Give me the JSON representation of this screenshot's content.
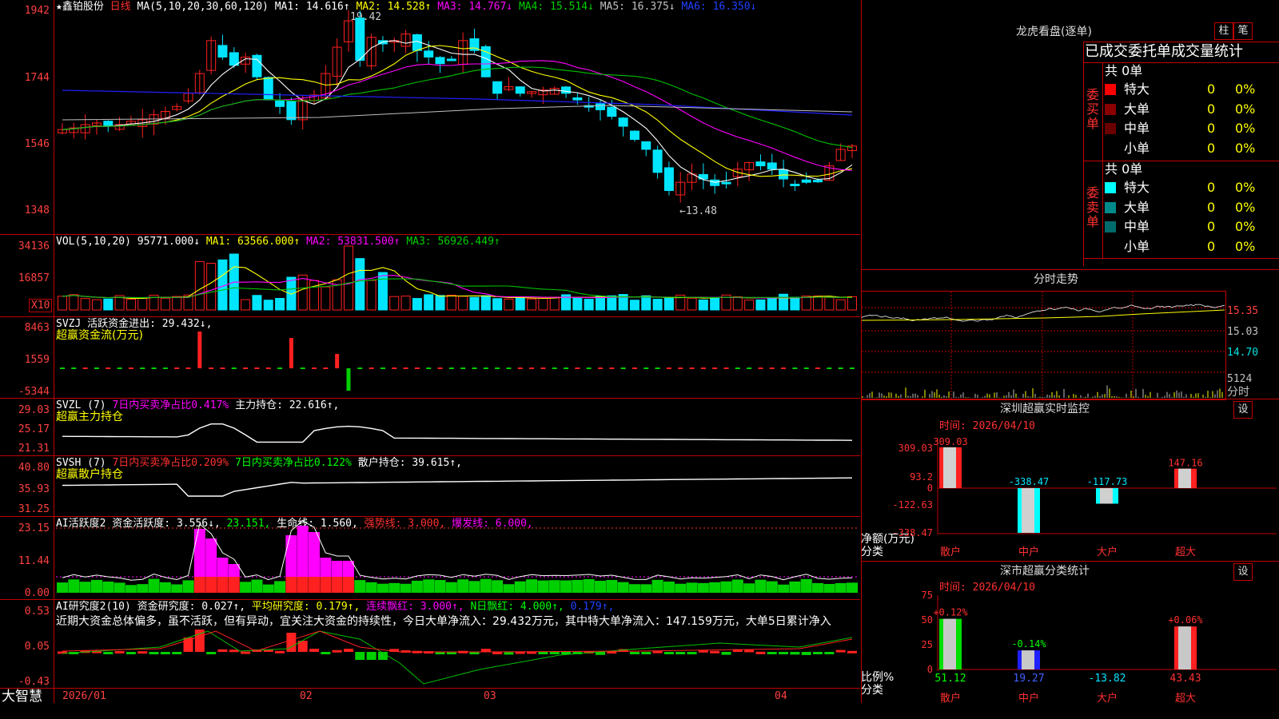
{
  "colors": {
    "up": "#ff2020",
    "down": "#00e5ff",
    "border": "#c00000",
    "axis": "#ff3030",
    "white": "#ffffff",
    "yellow": "#ffff00",
    "magenta": "#ff00ff",
    "green": "#00c000",
    "blue": "#2020ff",
    "gray": "#c0c0c0"
  },
  "main": {
    "star_name": "★鑫铂股份",
    "period": "日线",
    "ma_label": "MA(5,10,20,30,60,120)",
    "ma1": "MA1: 14.616↑",
    "ma2": "MA2: 14.528↑",
    "ma3": "MA3: 14.767↓",
    "ma4": "MA4: 15.514↓",
    "ma5": "MA5: 16.375↓",
    "ma6": "MA6: 16.350↓",
    "y_ticks": [
      "1942",
      "1744",
      "1546",
      "1348"
    ],
    "high_mark": "19.42",
    "low_mark": "←13.48",
    "x_dates": [
      "2026/01",
      "02",
      "03",
      "04"
    ]
  },
  "vol": {
    "label": "VOL(5,10,20)",
    "v": "95771.000↓",
    "ma1": "MA1: 63566.000↑",
    "ma2": "MA2: 53831.500↑",
    "ma3": "MA3: 56926.449↑",
    "y_ticks": [
      "34136",
      "16857"
    ],
    "unit": "X10"
  },
  "svzj": {
    "title": "SVZJ  活跃资金进出: 29.432↓,",
    "sub": "超赢资金流(万元)",
    "y_ticks": [
      "8463",
      "1559",
      "-5344"
    ]
  },
  "svzl": {
    "prefix": "SVZL (7)",
    "p1": "7日内买卖净占比0.417%",
    "p2": "主力持仓: 22.616↑,",
    "sub": "超赢主力持仓",
    "y_ticks": [
      "29.03",
      "25.17",
      "21.31"
    ]
  },
  "svsh": {
    "prefix": "SVSH (7)",
    "p1": "7日内买卖净占比0.209%",
    "p2": "7日内买卖净占比0.122%",
    "p3": "散户持仓: 39.615↑,",
    "sub": "超赢散户持仓",
    "y_ticks": [
      "40.80",
      "35.93",
      "31.25"
    ]
  },
  "ai_act": {
    "title": "AI活跃度2  资金活跃度: 3.556↓,",
    "v2": "23.151,",
    "life": "生命线: 1.560,",
    "strong": "强势线: 3.000,",
    "burst": "爆发线: 6.000,",
    "y_ticks": [
      "23.15",
      "11.44",
      "0.00"
    ]
  },
  "ai_res": {
    "title": "AI研究度2(10)  资金研究度: 0.027↑,",
    "avg": "平均研究度: 0.179↑,",
    "red": "连续飘红: 3.000↑,",
    "nred": "N日飘红: 4.000↑,",
    "v": "0.179↑,",
    "comment": "近期大资金总体偏多，虽不活跃，但有异动，宜关注大资金的持续性，今日大单净流入：29.432万元，其中特大单净流入：147.159万元，大单5日累计净入",
    "y_ticks": [
      "0.53",
      "0.05",
      "-0.43"
    ]
  },
  "logo": "大智慧",
  "right": {
    "lhb_title": "龙虎看盘(逐单)",
    "btn_bar": "柱",
    "btn_pen": "笔",
    "tabs_line": "已成交委托单成交量统计",
    "buy_side": "委买单",
    "sell_side": "委卖单",
    "buy_total": "共 0单",
    "sell_total": "共 0单",
    "rows": [
      {
        "label": "特大",
        "count": "0",
        "pct": "0%"
      },
      {
        "label": "大单",
        "count": "0",
        "pct": "0%"
      },
      {
        "label": "中单",
        "count": "0",
        "pct": "0%"
      },
      {
        "label": "小单",
        "count": "0",
        "pct": "0%"
      }
    ],
    "intraday_title": "分时走势",
    "intraday_ticks": [
      "15.35",
      "15.03",
      "14.70",
      "5124",
      "分时"
    ],
    "sz_title": "深圳超赢实时监控",
    "sz_time": "时间: 2026/04/10",
    "sz_btn": "设",
    "sz_y": [
      "309.03",
      "93.2",
      "0",
      "-122.63",
      "-338.47"
    ],
    "sz_ylabel": "净额(万元)",
    "sz_xlabel": "分类",
    "sz_bars": [
      {
        "cat": "散户",
        "value": 309.03,
        "label": "309.03"
      },
      {
        "cat": "中户",
        "value": -338.47,
        "label": "-338.47"
      },
      {
        "cat": "大户",
        "value": -117.73,
        "label": "-117.73"
      },
      {
        "cat": "超大",
        "value": 147.16,
        "label": "147.16"
      }
    ],
    "cls_title": "深市超赢分类统计",
    "cls_time": "时间: 2026/04/10",
    "cls_btn": "设",
    "cls_y": [
      "75",
      "50",
      "25",
      "0"
    ],
    "cls_ylabel": "比例%",
    "cls_xlabel": "分类",
    "cls_bars": [
      {
        "cat": "散户",
        "value": 51.12,
        "label": "51.12",
        "top": "+0.12%"
      },
      {
        "cat": "中户",
        "value": 19.27,
        "label": "19.27",
        "top": "-0.14%"
      },
      {
        "cat": "大户",
        "value": -13.82,
        "label": "-13.82",
        "top": ""
      },
      {
        "cat": "超大",
        "value": 43.43,
        "label": "43.43",
        "top": "+0.06%"
      }
    ]
  }
}
